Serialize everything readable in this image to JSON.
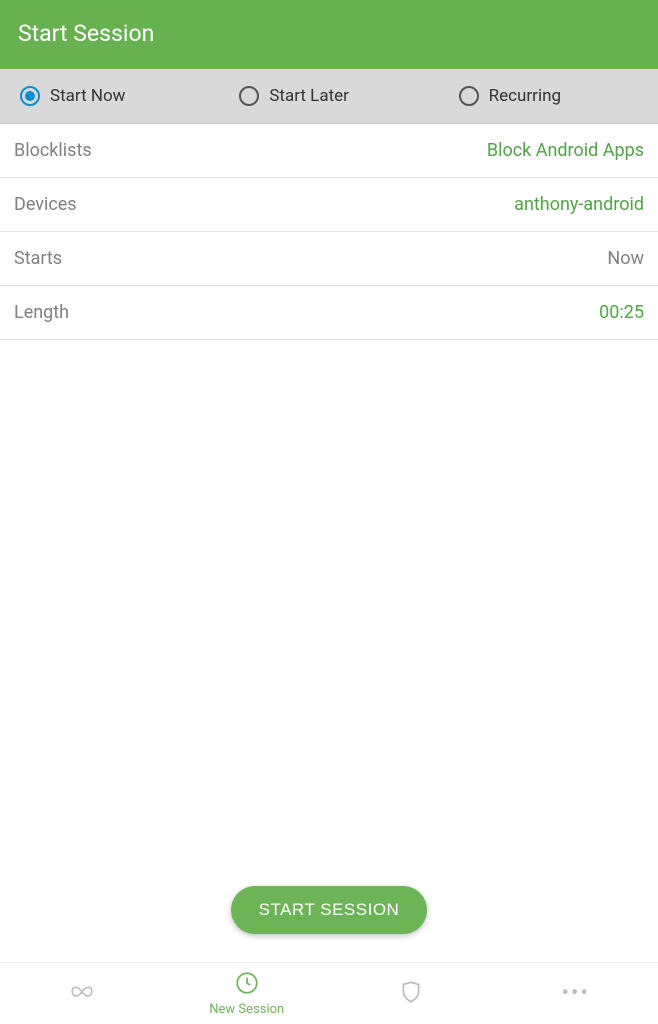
{
  "header": {
    "title": "Start Session"
  },
  "segmented": {
    "options": [
      {
        "label": "Start Now",
        "selected": true
      },
      {
        "label": "Start Later",
        "selected": false
      },
      {
        "label": "Recurring",
        "selected": false
      }
    ]
  },
  "rows": {
    "blocklists": {
      "label": "Blocklists",
      "value": "Block Android Apps"
    },
    "devices": {
      "label": "Devices",
      "value": "anthony-android"
    },
    "starts": {
      "label": "Starts",
      "value": "Now"
    },
    "length": {
      "label": "Length",
      "value": "00:25"
    }
  },
  "cta": {
    "label": "START SESSION"
  },
  "tabs": {
    "new_session": {
      "label": "New Session"
    }
  }
}
